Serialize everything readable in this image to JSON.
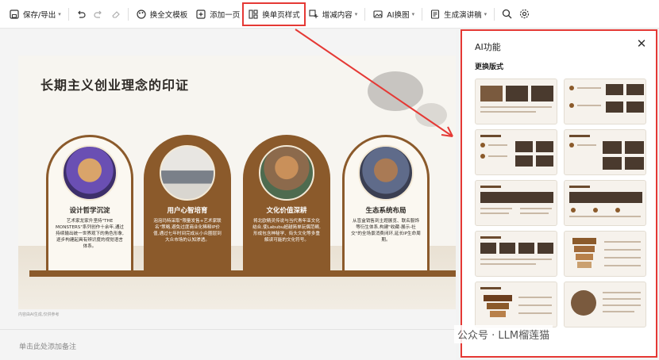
{
  "toolbar": {
    "save_export": "保存/导出",
    "replace_template": "换全文模板",
    "add_page": "添加一页",
    "replace_page_style": "换单页样式",
    "add_remove_content": "增减内容",
    "ai_image": "AI换图",
    "generate_script": "生成演讲稿"
  },
  "slide": {
    "title": "长期主义创业理念的印证",
    "cards": [
      {
        "title": "设计哲学沉淀",
        "text": "艺术家龙家升坚持\"THE MONSTERS\"系列创作十余年,通过持续输出统一世界观下的角色形象,逐步构建起具有辨识度的视觉语言体系。"
      },
      {
        "title": "用户心智培育",
        "text": "泡泡玛特采取\"限量发售+艺术家联名\"策略,避免过度商业化稀释IP价值,通过七年时间完成从小众圈层到大众市场的认知渗透。"
      },
      {
        "title": "文化价值深耕",
        "text": "将北欧精灵传说与当代青年亚文化结合,使Labubu超越简单玩偶范畴,形成包含神秘学、街头文化等多重解读可能的文化符号。"
      },
      {
        "title": "生态系统布局",
        "text": "从盲盒销售到主题展览、联名服饰等衍生体系,构建\"收藏-展示-社交\"的全场景消费闭环,延长IP生命周期。"
      }
    ],
    "footer": "内容由AI生成,仅供参考"
  },
  "notes": {
    "placeholder": "单击此处添加备注"
  },
  "panel": {
    "title": "AI功能",
    "subtitle": "更换版式"
  },
  "watermark": "公众号 · LLM榴莲猫",
  "colors": {
    "accent_red": "#e53935",
    "brand_brown": "#8b5a2b"
  }
}
